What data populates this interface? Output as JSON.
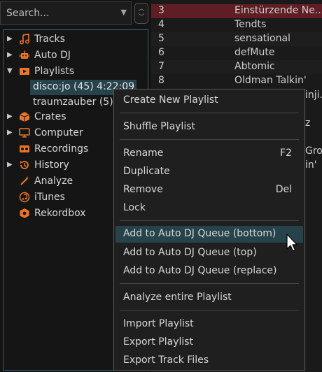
{
  "search": {
    "placeholder": "Search..."
  },
  "sidebar": {
    "items": [
      {
        "label": "Tracks",
        "icon": "music-note-icon",
        "expandable": true
      },
      {
        "label": "Auto DJ",
        "icon": "robot-icon",
        "expandable": true
      },
      {
        "label": "Playlists",
        "icon": "playlist-icon",
        "expandable": true,
        "expanded": true
      },
      {
        "label": "Crates",
        "icon": "crate-icon",
        "expandable": true
      },
      {
        "label": "Computer",
        "icon": "monitor-icon",
        "expandable": true
      },
      {
        "label": "Recordings",
        "icon": "tape-icon",
        "expandable": false
      },
      {
        "label": "History",
        "icon": "history-icon",
        "expandable": true
      },
      {
        "label": "Analyze",
        "icon": "wand-icon",
        "expandable": false
      },
      {
        "label": "iTunes",
        "icon": "itunes-icon",
        "expandable": false
      },
      {
        "label": "Rekordbox",
        "icon": "rekordbox-icon",
        "expandable": false
      }
    ],
    "playlists": [
      {
        "label": "disco:jo (45) 4:22:09",
        "selected": true
      },
      {
        "label": "traumzauber (5)",
        "selected": false
      }
    ]
  },
  "tracks": {
    "rows": [
      {
        "num": "3",
        "title": "Einstürzende Ne...",
        "highlighted": true
      },
      {
        "num": "4",
        "title": "Tendts"
      },
      {
        "num": "5",
        "title": "sensational"
      },
      {
        "num": "6",
        "title": "defMute"
      },
      {
        "num": "7",
        "title": "Abtomic"
      },
      {
        "num": "8",
        "title": "Oldman Talkin'"
      }
    ],
    "partial_right": [
      "inji..",
      "z",
      "Gro..",
      "in'"
    ]
  },
  "context_menu": {
    "items": [
      {
        "label": "Create New Playlist"
      },
      {
        "label": "Shuffle Playlist"
      },
      {
        "label": "Rename",
        "shortcut": "F2"
      },
      {
        "label": "Duplicate"
      },
      {
        "label": "Remove",
        "shortcut": "Del"
      },
      {
        "label": "Lock"
      },
      {
        "label": "Add to Auto DJ Queue (bottom)",
        "highlighted": true
      },
      {
        "label": "Add to Auto DJ Queue (top)"
      },
      {
        "label": "Add to Auto DJ Queue (replace)"
      },
      {
        "label": "Analyze entire Playlist"
      },
      {
        "label": "Import Playlist"
      },
      {
        "label": "Export Playlist"
      },
      {
        "label": "Export Track Files"
      }
    ]
  },
  "colors": {
    "accent": "#e8762c",
    "selection": "#26434c",
    "highlight_row": "#5e1e24",
    "tree_border": "#2f5f66"
  }
}
